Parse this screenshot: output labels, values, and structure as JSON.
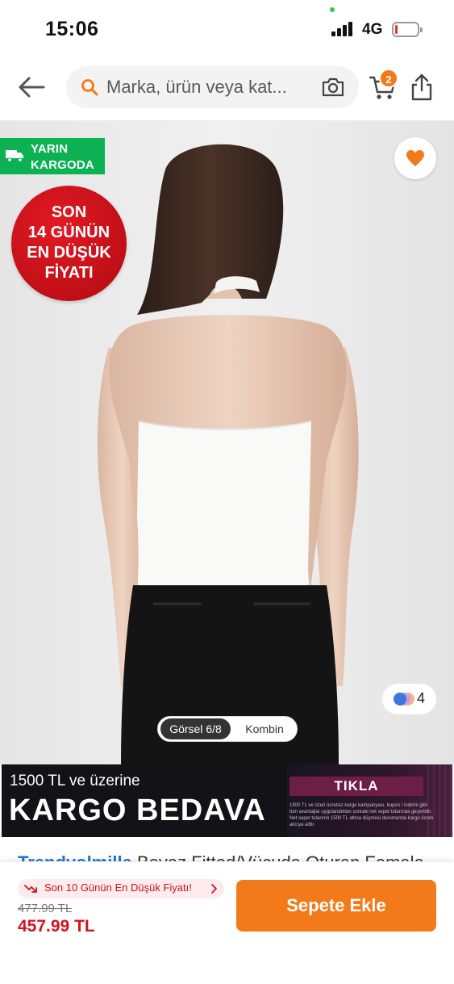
{
  "status_bar": {
    "time": "15:06",
    "network": "4G",
    "battery_level": 0.1,
    "battery_color": "#e5342b"
  },
  "header": {
    "back_icon": "arrow-left-icon",
    "search_placeholder": "Marka, ürün veya kategori ara",
    "search_display": "Marka, ürün veya kat...",
    "camera_icon": "camera-icon",
    "cart_icon": "cart-icon",
    "cart_count": "2",
    "share_icon": "share-icon",
    "accent_color": "#f27a1a"
  },
  "product": {
    "cargo_badge": {
      "line1": "YARIN",
      "line2": "KARGODA",
      "icon": "truck-icon",
      "color": "#0bb153"
    },
    "price_seal": {
      "line1": "SON",
      "line2": "14 GÜNÜN",
      "line3": "EN DÜŞÜK",
      "line4": "FİYATI",
      "color": "#c10f17"
    },
    "favorite_icon": "heart-icon",
    "favorite_active": true,
    "color_options_count": "4",
    "image_tabs": {
      "active": "Görsel 6/8",
      "inactive": "Kombin"
    },
    "image_index": 6,
    "image_total": 8
  },
  "promo": {
    "line_small": "1500 TL ve üzerine",
    "line_big": "KARGO BEDAVA",
    "cta": "TIKLA",
    "disclaimer": "1500 TL ve üzeri ücretsiz kargo kampanyası, kupon / indirim gibi tüm avantajlar uygulandıktan sonraki net sepet tutarında geçerlidir. Net sepet tutarının 1500 TL altına düşmesi durumunda kargo ücreti alıcıya aittir."
  },
  "title_peek": {
    "brand": "Trendyolmilla",
    "rest": " Beyaz Fitted/Vücuda Oturan Female"
  },
  "bottom_bar": {
    "low_price_label": "Son 10 Günün En Düşük Fiyatı!",
    "old_price": "477.99 TL",
    "new_price": "457.99 TL",
    "add_to_cart_label": "Sepete Ekle",
    "price_color": "#d0141f",
    "button_color": "#f27a1a"
  }
}
